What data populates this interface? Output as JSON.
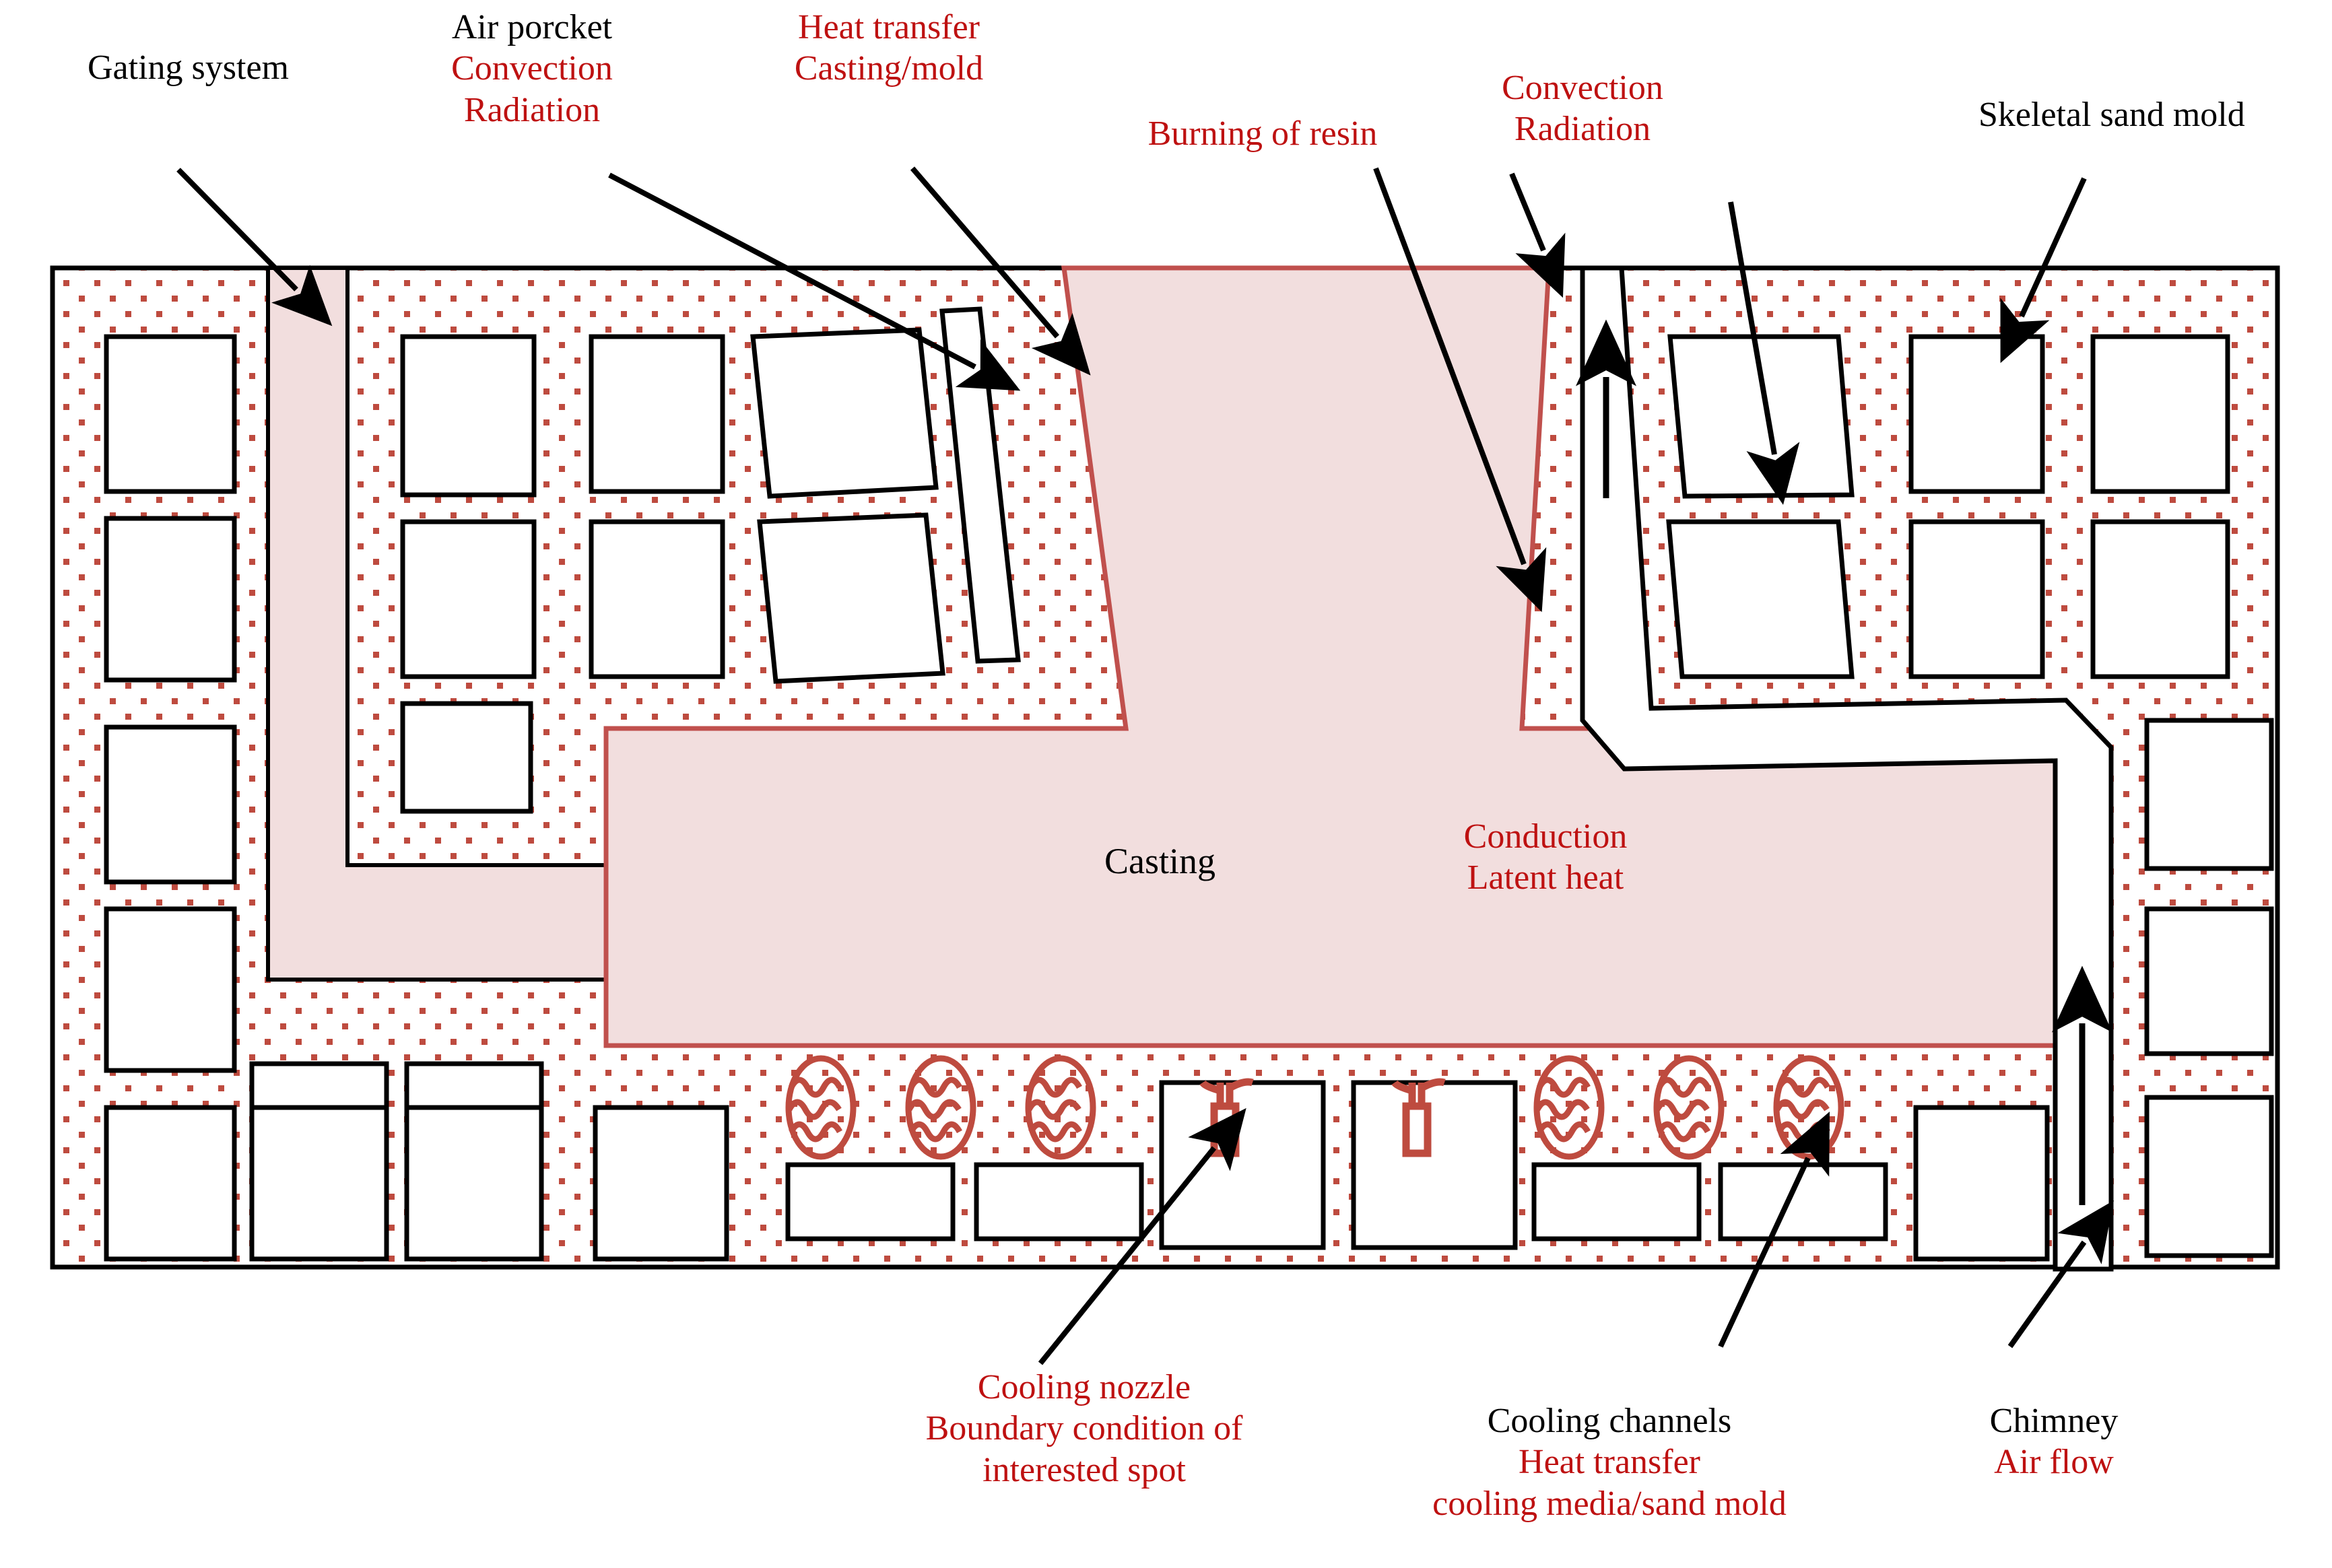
{
  "figure": {
    "title": "Skeletal sand mold casting heat-transfer schematic",
    "colors": {
      "sand_dot": "#BE4B3F",
      "casting_fill": "#F2DEDE",
      "casting_stroke": "#C0504D",
      "red_text": "#BE1111",
      "black_text": "#000000",
      "outline": "#000000",
      "background": "#FFFFFF"
    }
  },
  "labels": {
    "gating_system": {
      "black": [
        "Gating system"
      ],
      "red": []
    },
    "air_pocket": {
      "black": [
        "Air porcket"
      ],
      "red": [
        "Convection",
        "Radiation"
      ]
    },
    "heat_transfer_cm": {
      "black": [],
      "red": [
        "Heat transfer",
        "Casting/mold"
      ]
    },
    "burning_of_resin": {
      "black": [],
      "red": [
        "Burning of resin"
      ]
    },
    "convection_radiation_right": {
      "black": [],
      "red": [
        "Convection",
        "Radiation"
      ]
    },
    "skeletal_sand_mold": {
      "black": [
        "Skeletal sand mold"
      ],
      "red": []
    },
    "casting": {
      "black": [
        "Casting"
      ],
      "red": []
    },
    "conduction_latent": {
      "black": [],
      "red": [
        "Conduction",
        "Latent heat"
      ]
    },
    "cooling_nozzle": {
      "black": [],
      "red": [
        "Cooling nozzle",
        "Boundary condition of",
        "interested spot"
      ]
    },
    "cooling_channels": {
      "black": [
        "Cooling channels"
      ],
      "red": [
        "Heat transfer",
        "cooling media/sand mold"
      ]
    },
    "chimney": {
      "black": [
        "Chimney"
      ],
      "red": [
        "Air flow"
      ]
    }
  },
  "icons": {
    "cooling_channel": "cooling-channel-icon",
    "cooling_nozzle": "cooling-nozzle-icon",
    "air_flow_arrow": "air-flow-arrow-icon"
  },
  "counts": {
    "cooling_channel_symbols": 6,
    "cooling_nozzle_symbols": 2,
    "air_flow_arrows": 2
  }
}
